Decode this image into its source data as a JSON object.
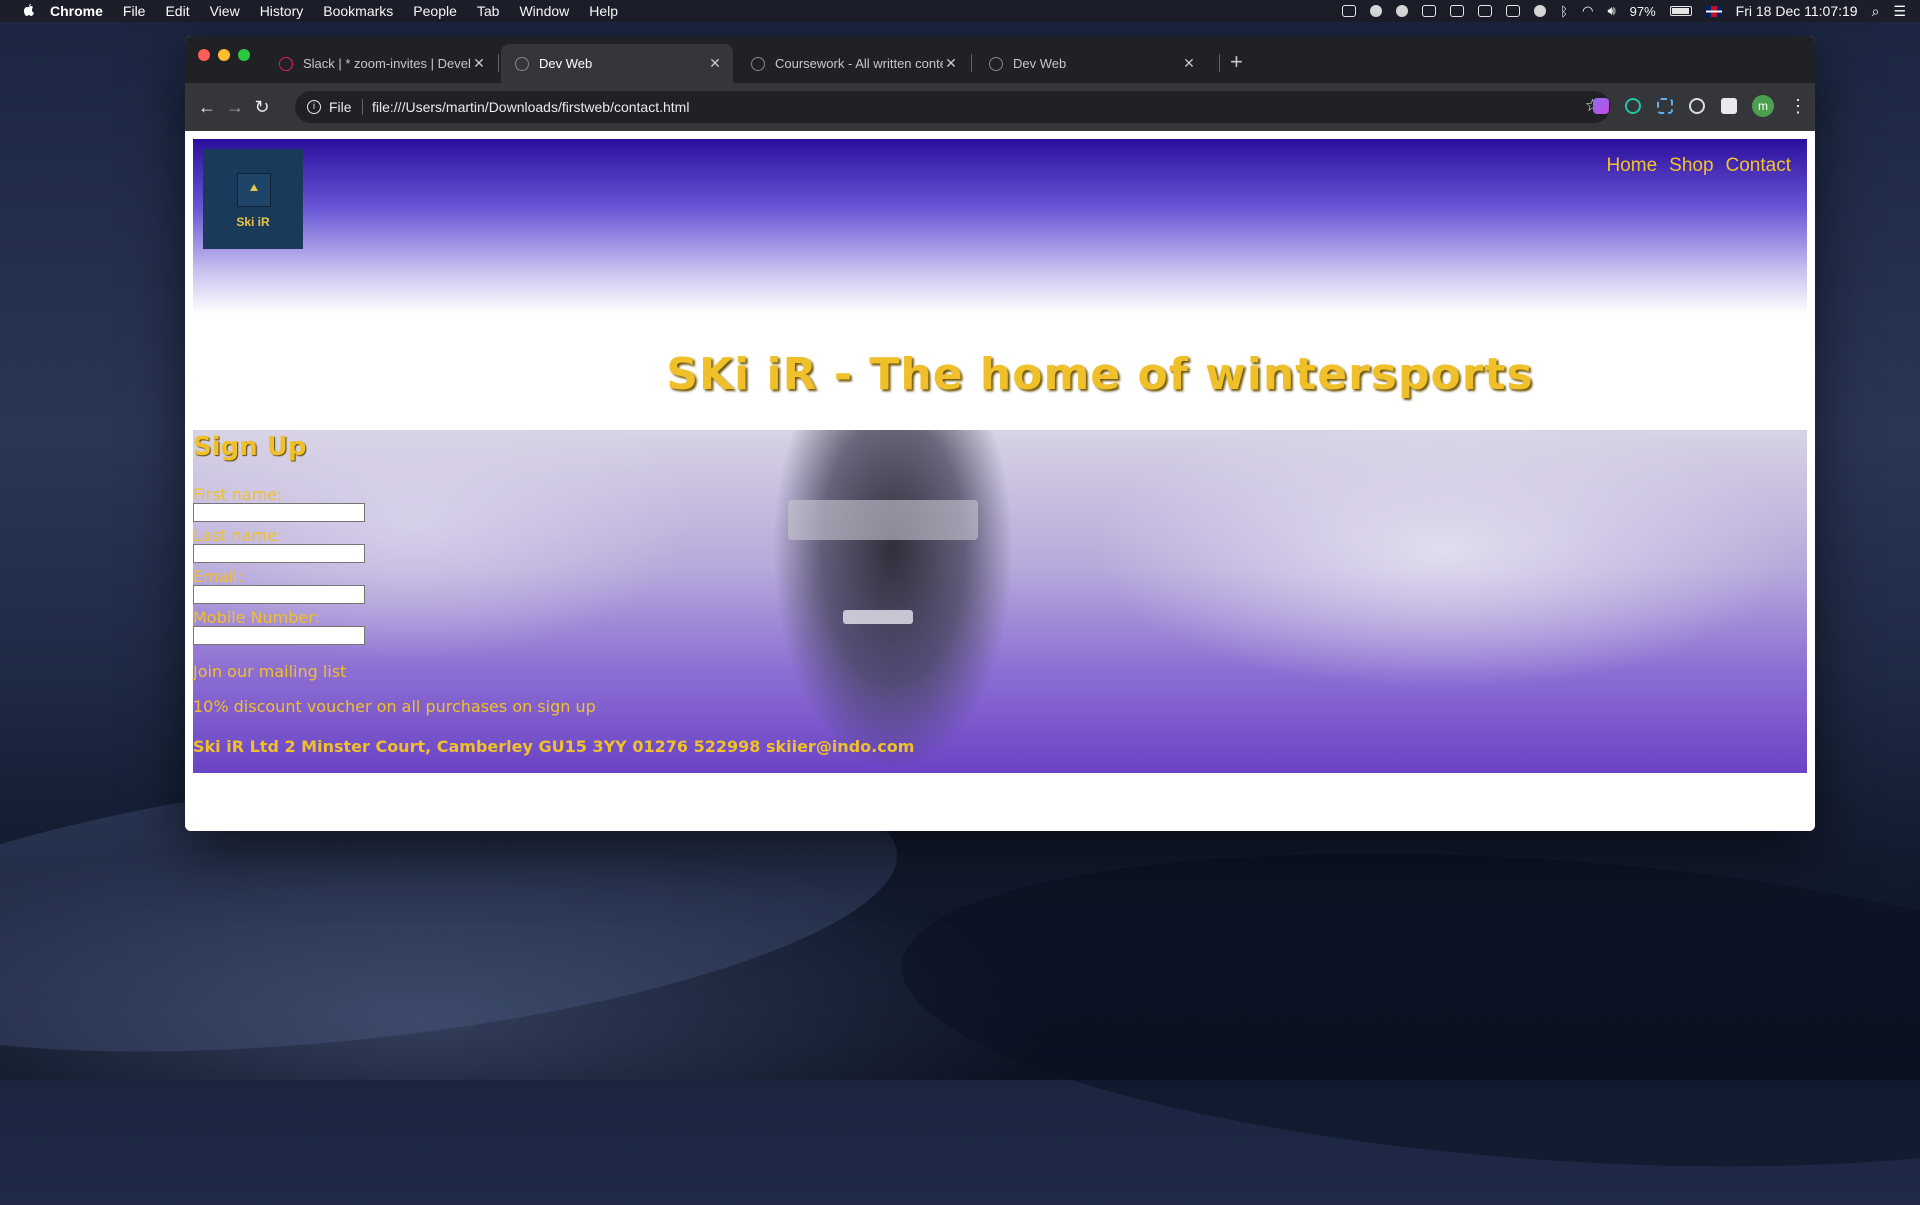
{
  "menubar": {
    "app": "Chrome",
    "menus": [
      "File",
      "Edit",
      "View",
      "History",
      "Bookmarks",
      "People",
      "Tab",
      "Window",
      "Help"
    ],
    "battery": "97%",
    "datetime": "Fri 18 Dec  11:07:19"
  },
  "browser": {
    "tabs": [
      {
        "title": "Slack | * zoom-invites | Develo",
        "close": "✕"
      },
      {
        "title": "Dev Web",
        "close": "✕"
      },
      {
        "title": "Coursework - All written conte",
        "close": "✕"
      },
      {
        "title": "Dev Web",
        "close": "✕"
      }
    ],
    "new_tab": "+",
    "scheme": "File",
    "url": "file:///Users/martin/Downloads/firstweb/contact.html",
    "profile_initial": "m"
  },
  "page": {
    "logo_text": "Ski iR",
    "nav": [
      "Home",
      "Shop",
      "Contact"
    ],
    "headline": "SKi iR - The home of wintersports",
    "form": {
      "heading": "Sign Up",
      "fields": [
        {
          "label": "First name:",
          "value": ""
        },
        {
          "label": "Last name:",
          "value": ""
        },
        {
          "label": "Email:",
          "value": ""
        },
        {
          "label": "Mobile Number:",
          "value": ""
        }
      ]
    },
    "mailing": "Join our mailing list",
    "discount": "10% discount voucher on all purchases on sign up",
    "footer": "Ski iR Ltd  2 Minster Court, Camberley GU15 3YY 01276 522998 skiier@indo.com"
  },
  "colors": {
    "accent_gold": "#f0c02a",
    "header_top": "#2a0e9c",
    "logo_bg": "#1a3a5c"
  }
}
